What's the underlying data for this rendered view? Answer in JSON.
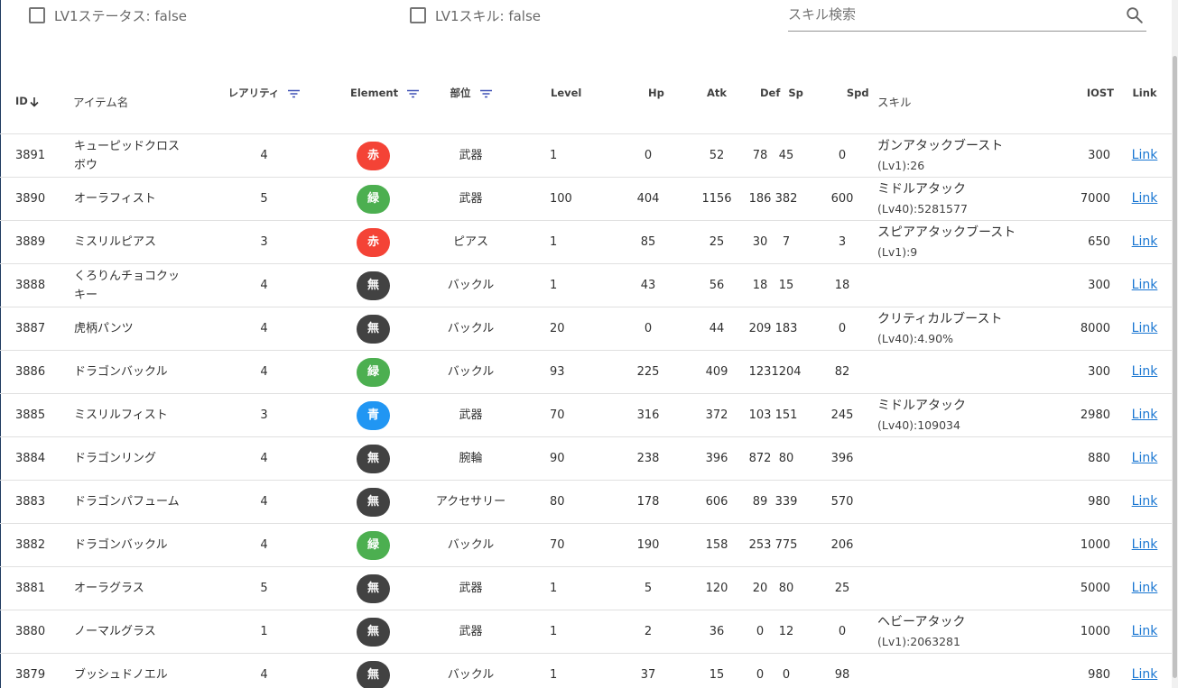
{
  "filters": {
    "lv1_status_label": "LV1ステータス: false",
    "lv1_skill_label": "LV1スキル: false"
  },
  "search": {
    "placeholder": "スキル検索",
    "value": "",
    "icon": "search-icon"
  },
  "colors": {
    "red": "#f44336",
    "green": "#4caf50",
    "blue": "#2196f3",
    "none": "#424242",
    "link": "#1976d2"
  },
  "table": {
    "headers": {
      "id": "ID",
      "name": "アイテム名",
      "rarity": "レアリティ",
      "element": "Element",
      "part": "部位",
      "level": "Level",
      "hp": "Hp",
      "atk": "Atk",
      "def": "Def",
      "sp": "Sp",
      "spd": "Spd",
      "skill": "スキル",
      "iost": "IOST",
      "link": "Link"
    },
    "rows": [
      {
        "id": "3891",
        "name": "キューピッドクロスボウ",
        "rarity": "4",
        "element": "赤",
        "element_color": "red",
        "part": "武器",
        "level": "1",
        "hp": "0",
        "atk": "52",
        "def": "78",
        "sp": "45",
        "spd": "0",
        "skill_name": "ガンアタックブースト",
        "skill_value": "(Lv1):26",
        "iost": "300",
        "link": "Link"
      },
      {
        "id": "3890",
        "name": "オーラフィスト",
        "rarity": "5",
        "element": "緑",
        "element_color": "green",
        "part": "武器",
        "level": "100",
        "hp": "404",
        "atk": "1156",
        "def": "186",
        "sp": "382",
        "spd": "600",
        "skill_name": "ミドルアタック",
        "skill_value": "(Lv40):5281577",
        "iost": "7000",
        "link": "Link"
      },
      {
        "id": "3889",
        "name": "ミスリルピアス",
        "rarity": "3",
        "element": "赤",
        "element_color": "red",
        "part": "ピアス",
        "level": "1",
        "hp": "85",
        "atk": "25",
        "def": "30",
        "sp": "7",
        "spd": "3",
        "skill_name": "スピアアタックブースト",
        "skill_value": "(Lv1):9",
        "iost": "650",
        "link": "Link"
      },
      {
        "id": "3888",
        "name": "くろりんチョコクッキー",
        "rarity": "4",
        "element": "無",
        "element_color": "none",
        "part": "バックル",
        "level": "1",
        "hp": "43",
        "atk": "56",
        "def": "18",
        "sp": "15",
        "spd": "18",
        "skill_name": "",
        "skill_value": "",
        "iost": "300",
        "link": "Link"
      },
      {
        "id": "3887",
        "name": "虎柄パンツ",
        "rarity": "4",
        "element": "無",
        "element_color": "none",
        "part": "バックル",
        "level": "20",
        "hp": "0",
        "atk": "44",
        "def": "209",
        "sp": "183",
        "spd": "0",
        "skill_name": "クリティカルブースト",
        "skill_value": "(Lv40):4.90%",
        "iost": "8000",
        "link": "Link"
      },
      {
        "id": "3886",
        "name": "ドラゴンバックル",
        "rarity": "4",
        "element": "緑",
        "element_color": "green",
        "part": "バックル",
        "level": "93",
        "hp": "225",
        "atk": "409",
        "def": "123",
        "sp": "1204",
        "spd": "82",
        "skill_name": "",
        "skill_value": "",
        "iost": "300",
        "link": "Link"
      },
      {
        "id": "3885",
        "name": "ミスリルフィスト",
        "rarity": "3",
        "element": "青",
        "element_color": "blue",
        "part": "武器",
        "level": "70",
        "hp": "316",
        "atk": "372",
        "def": "103",
        "sp": "151",
        "spd": "245",
        "skill_name": "ミドルアタック",
        "skill_value": "(Lv40):109034",
        "iost": "2980",
        "link": "Link"
      },
      {
        "id": "3884",
        "name": "ドラゴンリング",
        "rarity": "4",
        "element": "無",
        "element_color": "none",
        "part": "腕輪",
        "level": "90",
        "hp": "238",
        "atk": "396",
        "def": "872",
        "sp": "80",
        "spd": "396",
        "skill_name": "",
        "skill_value": "",
        "iost": "880",
        "link": "Link"
      },
      {
        "id": "3883",
        "name": "ドラゴンパフューム",
        "rarity": "4",
        "element": "無",
        "element_color": "none",
        "part": "アクセサリー",
        "level": "80",
        "hp": "178",
        "atk": "606",
        "def": "89",
        "sp": "339",
        "spd": "570",
        "skill_name": "",
        "skill_value": "",
        "iost": "980",
        "link": "Link"
      },
      {
        "id": "3882",
        "name": "ドラゴンバックル",
        "rarity": "4",
        "element": "緑",
        "element_color": "green",
        "part": "バックル",
        "level": "70",
        "hp": "190",
        "atk": "158",
        "def": "253",
        "sp": "775",
        "spd": "206",
        "skill_name": "",
        "skill_value": "",
        "iost": "1000",
        "link": "Link"
      },
      {
        "id": "3881",
        "name": "オーラグラス",
        "rarity": "5",
        "element": "無",
        "element_color": "none",
        "part": "武器",
        "level": "1",
        "hp": "5",
        "atk": "120",
        "def": "20",
        "sp": "80",
        "spd": "25",
        "skill_name": "",
        "skill_value": "",
        "iost": "5000",
        "link": "Link"
      },
      {
        "id": "3880",
        "name": "ノーマルグラス",
        "rarity": "1",
        "element": "無",
        "element_color": "none",
        "part": "武器",
        "level": "1",
        "hp": "2",
        "atk": "36",
        "def": "0",
        "sp": "12",
        "spd": "0",
        "skill_name": "ヘビーアタック",
        "skill_value": "(Lv1):2063281",
        "iost": "1000",
        "link": "Link"
      },
      {
        "id": "3879",
        "name": "ブッシュドノエル",
        "rarity": "4",
        "element": "無",
        "element_color": "none",
        "part": "バックル",
        "level": "1",
        "hp": "37",
        "atk": "15",
        "def": "0",
        "sp": "0",
        "spd": "98",
        "skill_name": "",
        "skill_value": "",
        "iost": "980",
        "link": "Link"
      }
    ]
  }
}
